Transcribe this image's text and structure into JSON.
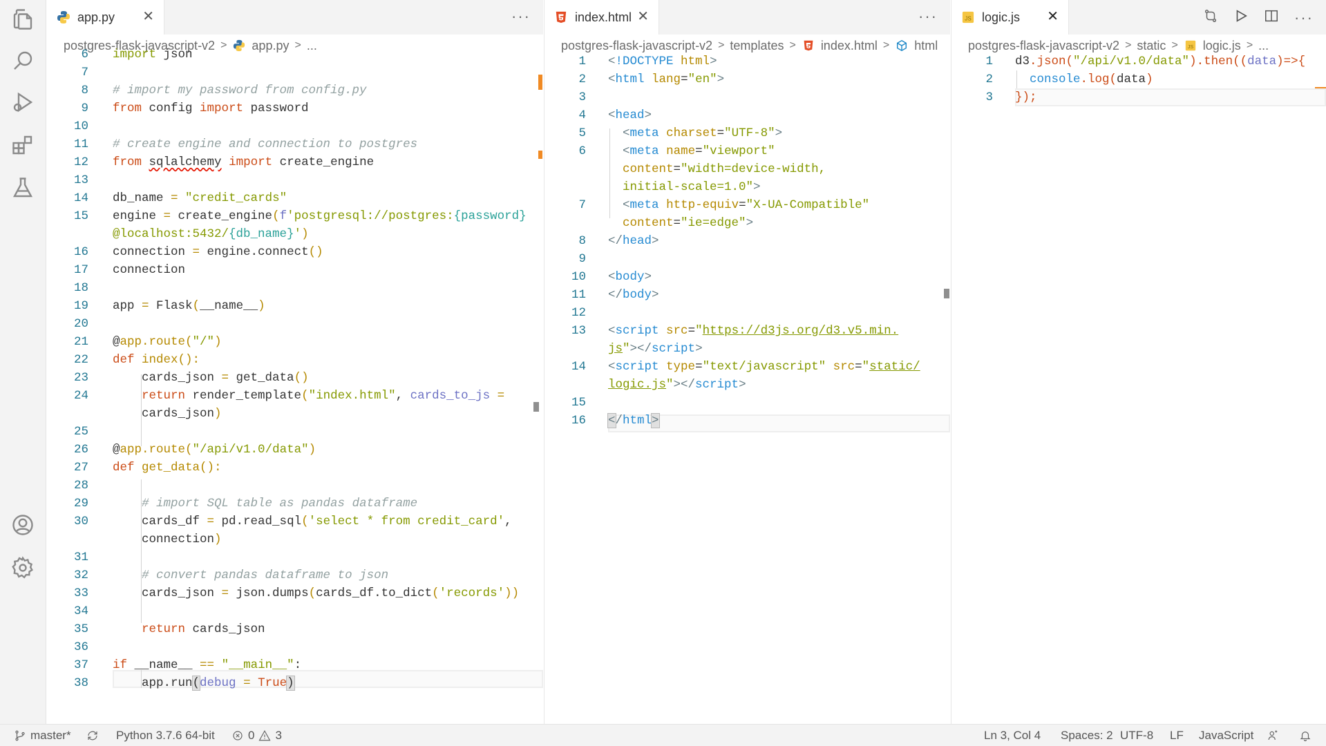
{
  "activity_bar": {
    "icons": [
      "files-icon",
      "search-icon",
      "run-debug-icon",
      "extensions-icon",
      "testing-icon",
      "account-icon",
      "settings-gear-icon"
    ]
  },
  "editor1": {
    "tab_label": "app.py",
    "breadcrumb": [
      "postgres-flask-javascript-v2",
      "app.py",
      "..."
    ],
    "line_numbers": [
      "6",
      "7",
      "8",
      "9",
      "10",
      "11",
      "12",
      "13",
      "14",
      "15",
      "16",
      "17",
      "18",
      "19",
      "20",
      "21",
      "22",
      "23",
      "24",
      "25",
      "26",
      "27",
      "28",
      "29",
      "30",
      "31",
      "32",
      "33",
      "34",
      "35",
      "36",
      "37",
      "38"
    ]
  },
  "editor2": {
    "tab_label": "index.html",
    "breadcrumb": [
      "postgres-flask-javascript-v2",
      "templates",
      "index.html",
      "html"
    ],
    "line_numbers": [
      "1",
      "2",
      "3",
      "4",
      "5",
      "6",
      "7",
      "8",
      "9",
      "10",
      "11",
      "12",
      "13",
      "14",
      "15",
      "16"
    ]
  },
  "editor3": {
    "tab_label": "logic.js",
    "breadcrumb": [
      "postgres-flask-javascript-v2",
      "static",
      "logic.js",
      "..."
    ],
    "line_numbers": [
      "1",
      "2",
      "3"
    ]
  },
  "tab_more": "···",
  "tab_close": "✕",
  "status_bar": {
    "branch": "master*",
    "interpreter": "Python 3.7.6 64-bit",
    "errors": "0",
    "warnings": "3",
    "cursor": "Ln 3, Col 4",
    "indent": "Spaces: 2",
    "encoding": "UTF-8",
    "eol": "LF",
    "language": "JavaScript"
  },
  "colors": {
    "keyword": "#859900",
    "string": "#2aa198",
    "comment": "#93a1a1",
    "line_number": "#237893",
    "modified_marker": "#f08a24"
  }
}
